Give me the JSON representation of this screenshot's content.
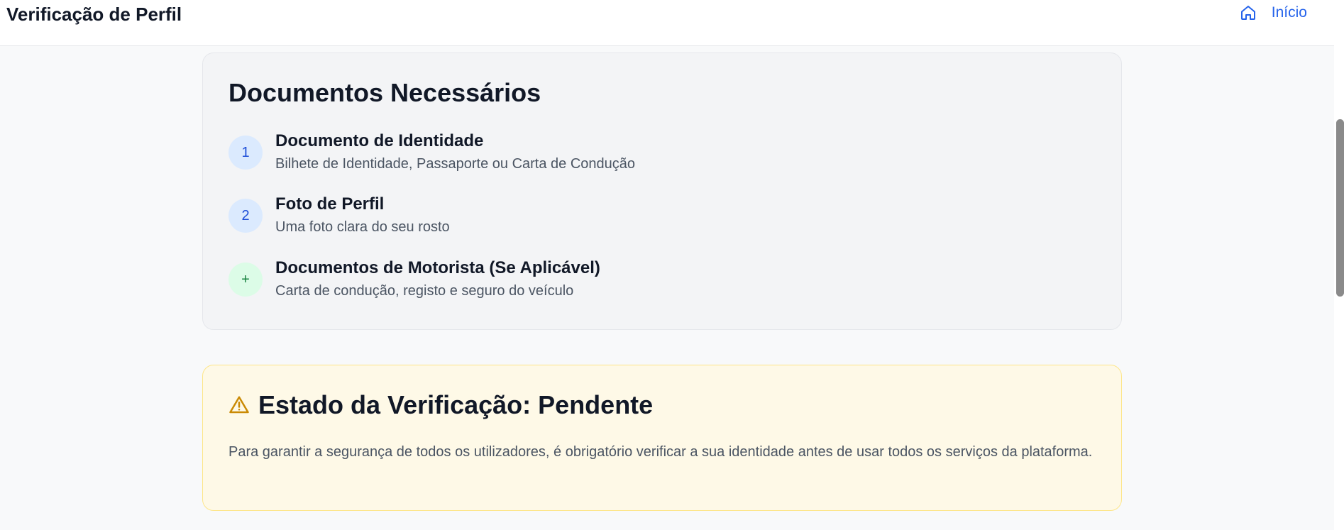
{
  "header": {
    "title": "Verificação de Perfil",
    "home_label": "Início"
  },
  "required_docs": {
    "heading": "Documentos Necessários",
    "items": [
      {
        "badge": "1",
        "title": "Documento de Identidade",
        "description": "Bilhete de Identidade, Passaporte ou Carta de Condução",
        "badge_color": "#1d4ed8"
      },
      {
        "badge": "2",
        "title": "Foto de Perfil",
        "description": "Uma foto clara do seu rosto",
        "badge_color": "#1d4ed8"
      },
      {
        "badge": "+",
        "title": "Documentos de Motorista (Se Aplicável)",
        "description": "Carta de condução, registo e seguro do veículo",
        "badge_color": "#15803d"
      }
    ]
  },
  "status": {
    "icon": "warning-icon",
    "title": "Estado da Verificação: Pendente",
    "message": "Para garantir a segurança de todos os utilizadores, é obrigatório verificar a sua identidade antes de usar todos os serviços da plataforma."
  },
  "colors": {
    "accent": "#2563eb",
    "warning": "#ca8a04",
    "warning_bg": "#fef9e7"
  }
}
